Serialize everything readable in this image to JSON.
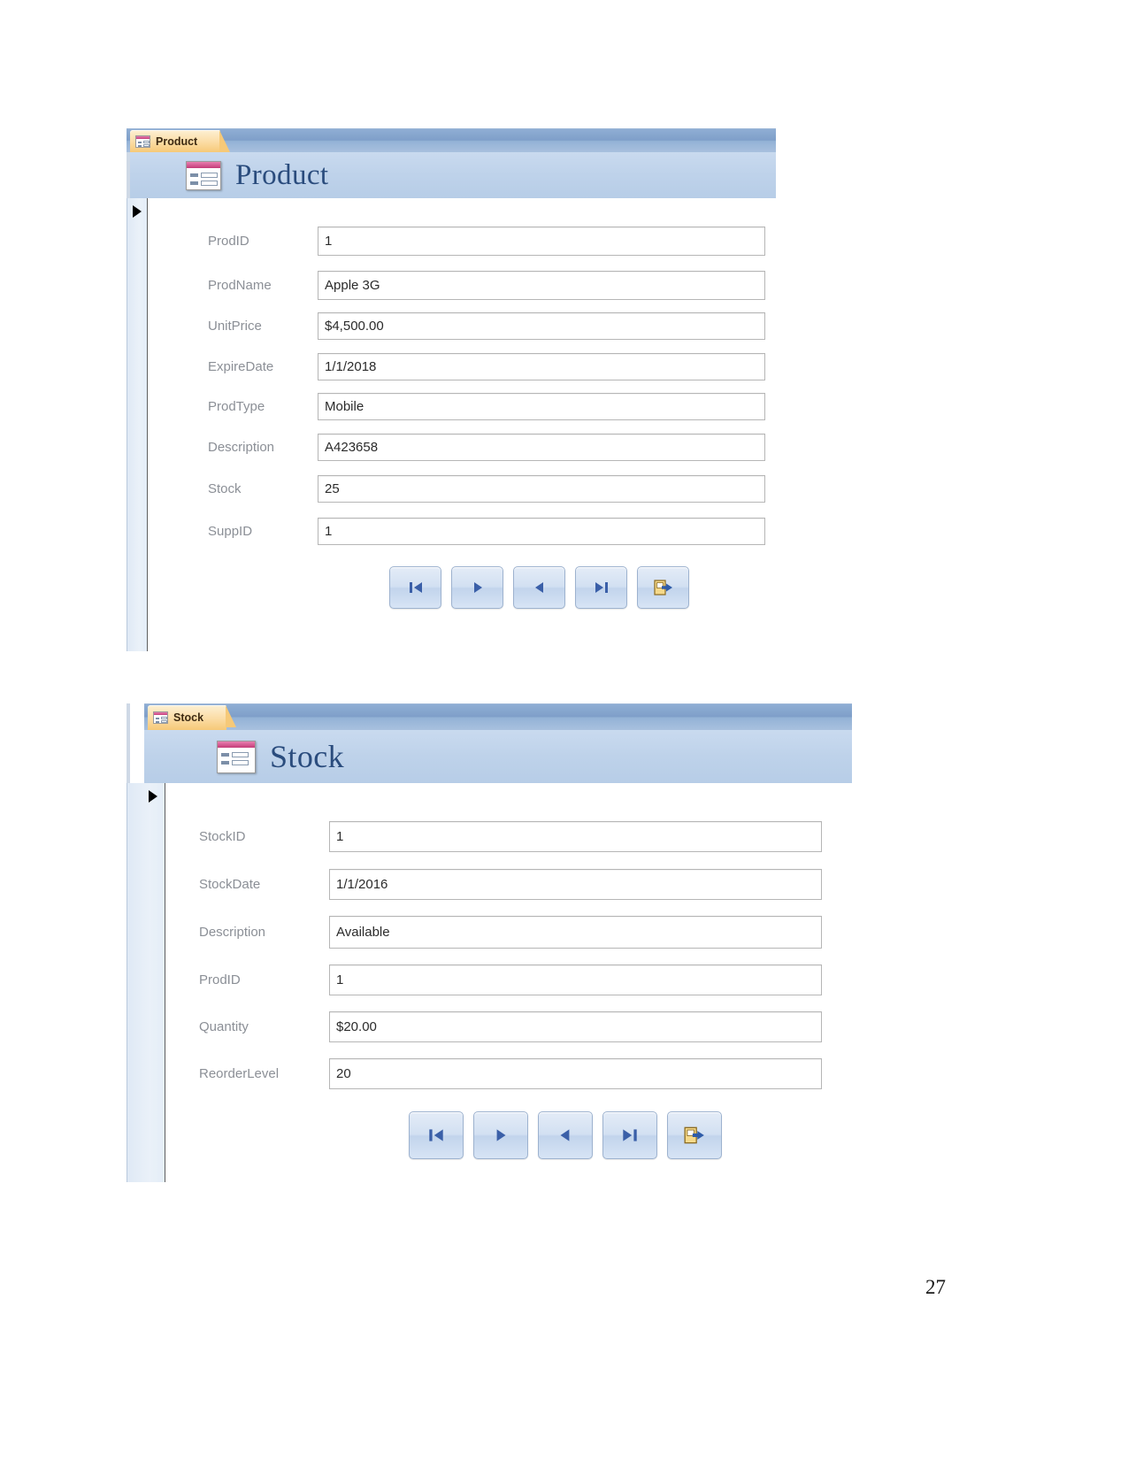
{
  "page": {
    "number": "27"
  },
  "forms": [
    {
      "id": "product",
      "tab_label": "Product",
      "tab_icon": "form-icon",
      "header_title": "Product",
      "header_icon": "form-icon",
      "fields": [
        {
          "label": "ProdID",
          "value": "1"
        },
        {
          "label": "ProdName",
          "value": "Apple 3G"
        },
        {
          "label": "UnitPrice",
          "value": "$4,500.00"
        },
        {
          "label": "ExpireDate",
          "value": "1/1/2018"
        },
        {
          "label": "ProdType",
          "value": "Mobile"
        },
        {
          "label": "Description",
          "value": "A423658"
        },
        {
          "label": "Stock",
          "value": "25"
        },
        {
          "label": "SuppID",
          "value": "1"
        }
      ],
      "nav_buttons": [
        {
          "name": "first-record-button",
          "icon": "first-record-icon"
        },
        {
          "name": "next-record-button",
          "icon": "play-right-icon"
        },
        {
          "name": "previous-record-button",
          "icon": "play-left-icon"
        },
        {
          "name": "last-record-button",
          "icon": "last-record-icon"
        },
        {
          "name": "exit-form-button",
          "icon": "exit-door-icon"
        }
      ]
    },
    {
      "id": "stock",
      "tab_label": "Stock",
      "tab_icon": "form-icon",
      "header_title": "Stock",
      "header_icon": "form-icon",
      "fields": [
        {
          "label": "StockID",
          "value": "1"
        },
        {
          "label": "StockDate",
          "value": "1/1/2016"
        },
        {
          "label": "Description",
          "value": "Available"
        },
        {
          "label": "ProdID",
          "value": "1"
        },
        {
          "label": "Quantity",
          "value": "$20.00"
        },
        {
          "label": "ReorderLevel",
          "value": "20"
        }
      ],
      "nav_buttons": [
        {
          "name": "first-record-button",
          "icon": "first-record-icon"
        },
        {
          "name": "next-record-button",
          "icon": "play-right-icon"
        },
        {
          "name": "previous-record-button",
          "icon": "play-left-icon"
        },
        {
          "name": "last-record-button",
          "icon": "last-record-icon"
        },
        {
          "name": "exit-form-button",
          "icon": "exit-door-icon"
        }
      ]
    }
  ],
  "colors": {
    "tab_strip": "#8faed4",
    "tab_active": "#f6c978",
    "header_band": "#bed2ea",
    "header_title": "#2a4c7d",
    "field_label": "#8b8f96",
    "nav_glyph": "#3a5fa8"
  }
}
